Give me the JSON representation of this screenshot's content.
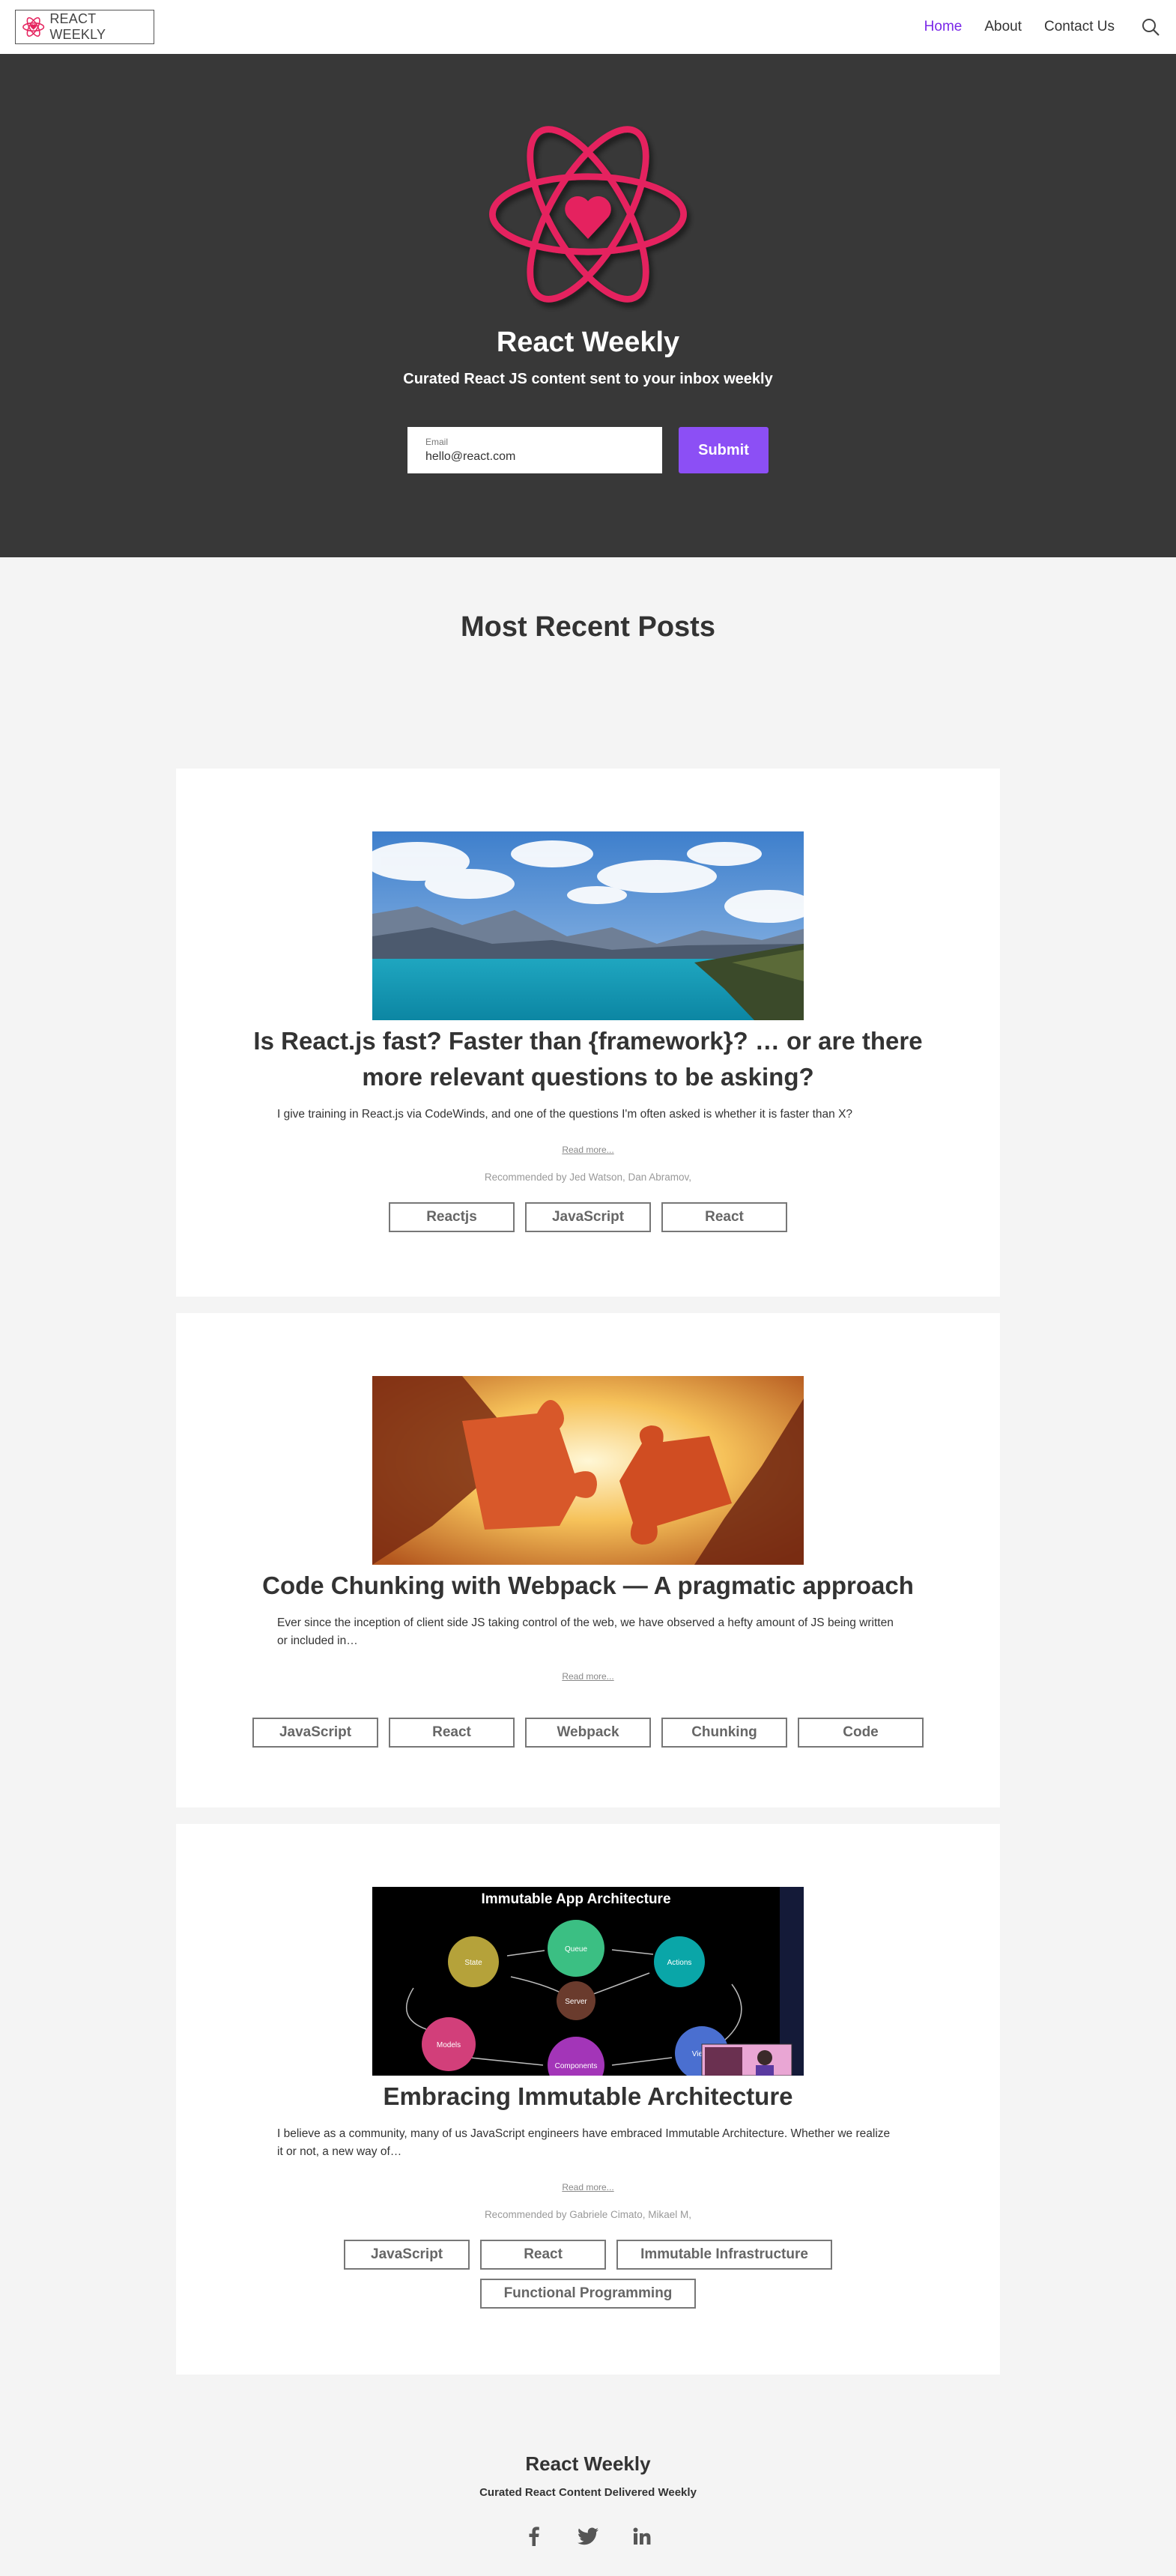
{
  "nav": {
    "logo_text": "REACT WEEKLY",
    "links": [
      {
        "label": "Home",
        "active": true
      },
      {
        "label": "About",
        "active": false
      },
      {
        "label": "Contact Us",
        "active": false
      }
    ],
    "search_icon": "search-icon"
  },
  "hero": {
    "title": "React Weekly",
    "subtitle": "Curated React JS content sent to your inbox weekly",
    "email_label": "Email",
    "email_value": "hello@react.com",
    "submit_label": "Submit"
  },
  "section_title": "Most Recent Posts",
  "posts": [
    {
      "image": "lake-mountains-photo",
      "title": "Is React.js fast? Faster than {framework}? … or are there more relevant questions to be asking?",
      "excerpt": "I give training in React.js via CodeWinds, and one of the questions I'm often asked is whether it is faster than X?",
      "read_more": "Read more...",
      "recommended": "Recommended by Jed Watson, Dan Abramov,",
      "tags": [
        "Reactjs",
        "JavaScript",
        "React"
      ]
    },
    {
      "image": "puzzle-pieces-photo",
      "title": "Code Chunking with Webpack — A pragmatic approach",
      "excerpt": "Ever since the inception of client side JS taking control of the web, we have observed a hefty amount of JS being written or included in…",
      "read_more": "Read more...",
      "recommended": "",
      "tags": [
        "JavaScript",
        "React",
        "Webpack",
        "Chunking",
        "Code"
      ]
    },
    {
      "image": "immutable-architecture-slide",
      "slide": {
        "title": "Immutable App Architecture",
        "nodes": [
          "Queue",
          "State",
          "Actions",
          "Server",
          "Models",
          "Components",
          "Views"
        ]
      },
      "title": "Embracing Immutable Architecture",
      "excerpt": "I believe as a community, many of us JavaScript engineers have embraced Immutable Architecture. Whether we realize it or not, a new way of…",
      "read_more": "Read more...",
      "recommended": "Recommended by Gabriele Cimato, Mikael M,",
      "tags": [
        "JavaScript",
        "React",
        "Immutable Infrastructure",
        "Functional Programming"
      ]
    }
  ],
  "footer": {
    "title": "React Weekly",
    "subtitle": "Curated React Content Delivered Weekly",
    "socials": [
      "facebook-icon",
      "twitter-icon",
      "linkedin-icon"
    ]
  },
  "colors": {
    "accent": "#8c4ff5",
    "active_link": "#7a28e8",
    "brand_pink": "#e5245f",
    "hero_bg": "#383838"
  }
}
